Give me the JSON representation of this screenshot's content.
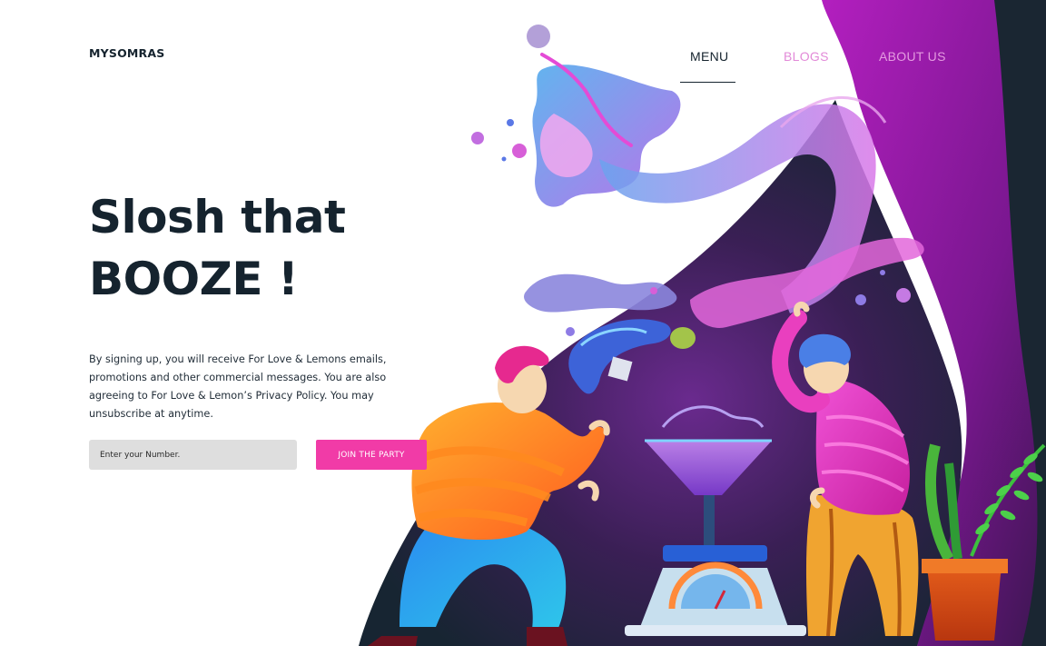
{
  "brand": {
    "name": "MYSOMRAS"
  },
  "nav": {
    "items": [
      {
        "label": "MENU"
      },
      {
        "label": "BLOGS"
      },
      {
        "label": "ABOUT US"
      }
    ]
  },
  "hero": {
    "line1": "Slosh that",
    "line2": "BOOZE !",
    "description": "By signing up, you will receive For Love & Lemons emails, promotions and other commercial messages. You are also agreeing to For Love & Lemon’s Privacy Policy. You may unsubscribe at anytime."
  },
  "signup": {
    "placeholder": "Enter your Number.",
    "button_label": "JOIN THE PARTY"
  },
  "colors": {
    "ink": "#15232e",
    "accent_pink": "#f13ba7",
    "nav_muted": "#e28ad8",
    "field_bg": "#dedede",
    "purple": "#8a1aa0",
    "dark": "#162430"
  },
  "illustration": {
    "subject": "two-people-mixing-cocktail-illustration"
  }
}
